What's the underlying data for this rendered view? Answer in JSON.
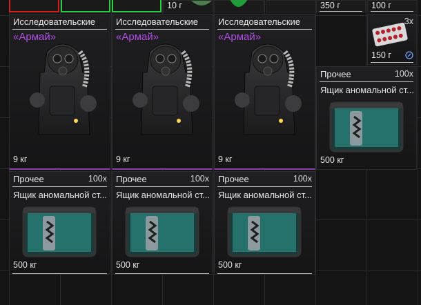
{
  "top_strip": {
    "weight_a": "10 г",
    "weight_b": "350 г",
    "weight_c": "100 г"
  },
  "pills_card": {
    "qty": "3x",
    "weight": "150 г"
  },
  "armor_cards": [
    {
      "category": "Исследовательские",
      "name": "«Армай»",
      "weight": "9 кг"
    },
    {
      "category": "Исследовательские",
      "name": "«Армай»",
      "weight": "9 кг"
    },
    {
      "category": "Исследовательские",
      "name": "«Армай»",
      "weight": "9 кг"
    }
  ],
  "box_cards": [
    {
      "category": "Прочее",
      "qty": "100x",
      "name": "Ящик аномальной ст...",
      "weight": "500 кг"
    },
    {
      "category": "Прочее",
      "qty": "100x",
      "name": "Ящик аномальной ст...",
      "weight": "500 кг"
    },
    {
      "category": "Прочее",
      "qty": "100x",
      "name": "Ящик аномальной ст...",
      "weight": "500 кг"
    },
    {
      "category": "Прочее",
      "qty": "100x",
      "name": "Ящик аномальной ст...",
      "weight": "500 кг"
    }
  ],
  "colors": {
    "accent_purple": "#b14fe6",
    "slot_red": "#d21f1f",
    "slot_green": "#2ecc46",
    "box_teal": "#2fb3a8"
  },
  "icons": {
    "armor": "armor-vest-icon",
    "box": "anomaly-crate-icon",
    "pills": "pills-blister-icon",
    "info": "info-icon"
  }
}
